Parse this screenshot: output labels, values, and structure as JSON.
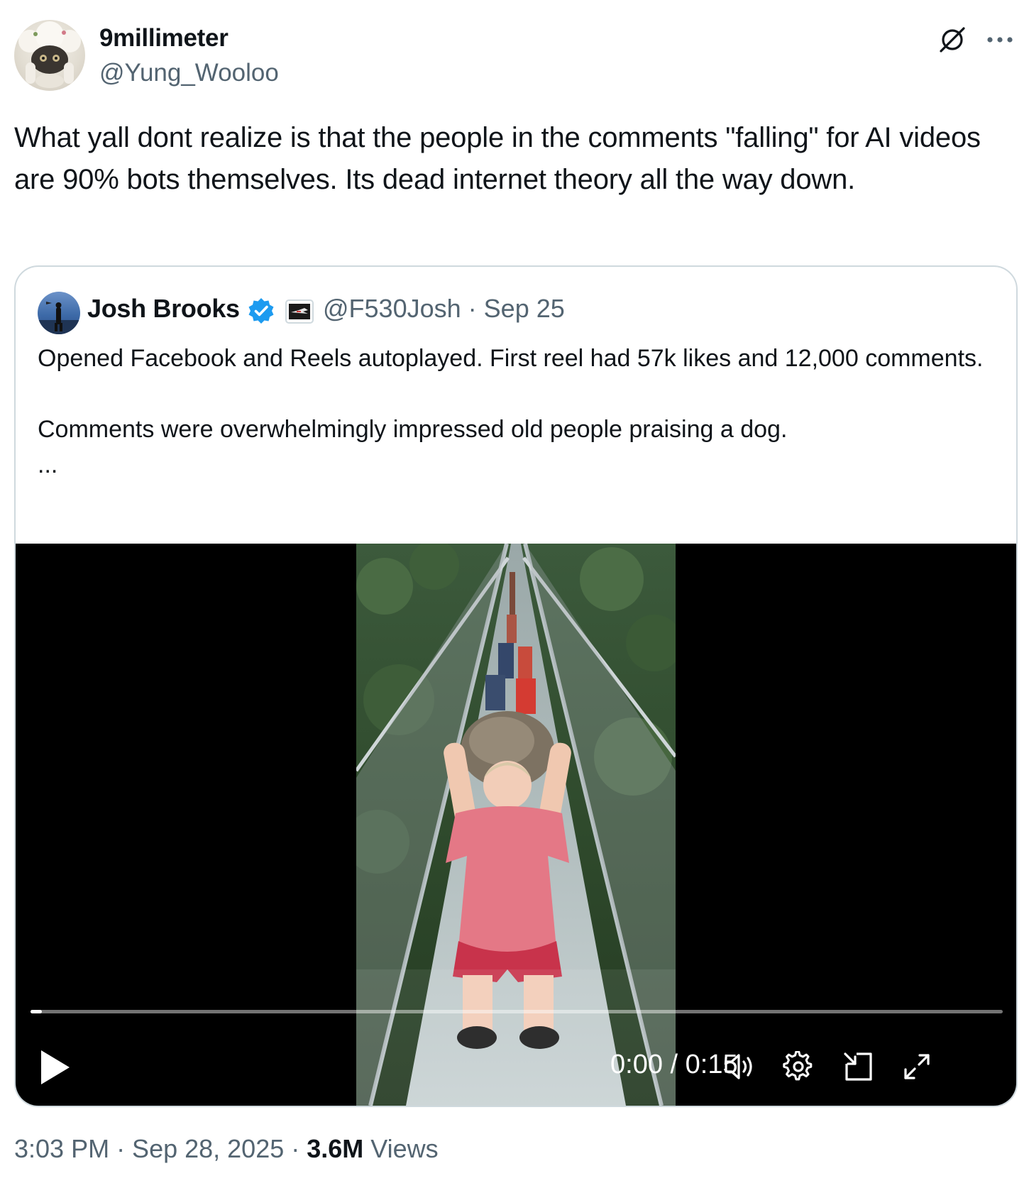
{
  "post": {
    "author_name": "9millimeter",
    "author_handle": "@Yung_Wooloo",
    "text": "What yall dont realize is that the people in the comments \"falling\" for AI videos are 90% bots themselves. Its dead internet theory all the way down.",
    "timestamp": "3:03 PM · Sep 28, 2025 · ",
    "views_count": "3.6M",
    "views_label": " Views"
  },
  "quote": {
    "author_name": "Josh Brooks",
    "author_handle": "@F530Josh",
    "separator": " · ",
    "date": "Sep 25",
    "text_line1": "Opened Facebook and Reels autoplayed. First reel had 57k likes and 12,000 comments.",
    "text_line2": "Comments were overwhelmingly impressed old people praising a dog.",
    "text_more": "..."
  },
  "video": {
    "current_time": "0:00",
    "duration": "0:15",
    "time_separator": " / ",
    "progress_fraction": 0.012
  },
  "icons": {
    "grok": "grok-icon",
    "more": "more-icon",
    "verified": "verified-badge-icon",
    "affiliate": "affiliate-badge-icon",
    "play": "play-icon",
    "volume": "volume-icon",
    "settings": "gear-icon",
    "pip": "picture-in-picture-icon",
    "fullscreen": "fullscreen-icon"
  },
  "colors": {
    "text_primary": "#0f1419",
    "text_secondary": "#536471",
    "border": "#cfd9de",
    "verified_blue": "#1d9bf0"
  }
}
